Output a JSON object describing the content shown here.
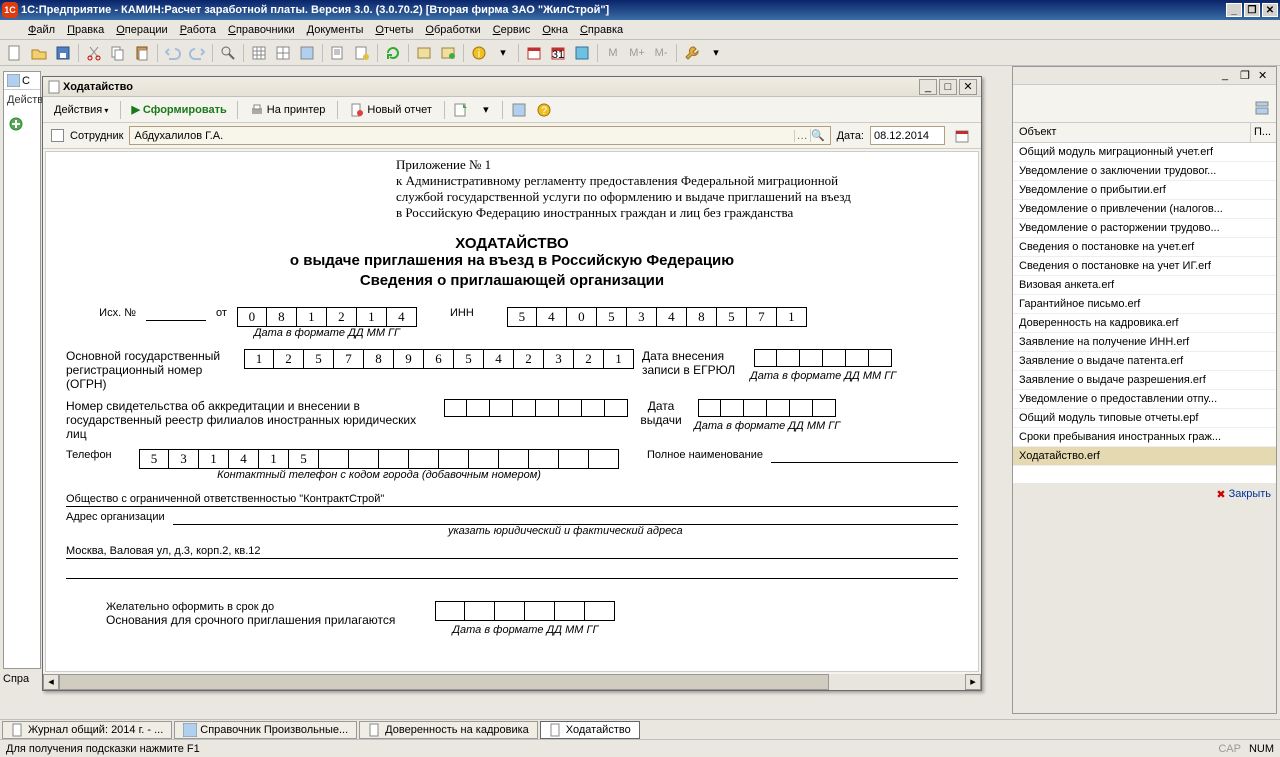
{
  "titlebar": "1С:Предприятие - КАМИН:Расчет заработной платы. Версия 3.0. (3.0.70.2) [Вторая фирма ЗАО \"ЖилСтрой\"]",
  "menu": [
    "Файл",
    "Правка",
    "Операции",
    "Работа",
    "Справочники",
    "Документы",
    "Отчеты",
    "Обработки",
    "Сервис",
    "Окна",
    "Справка"
  ],
  "leftbg": {
    "label1": "Действ",
    "label2": "Спра"
  },
  "modal": {
    "title": "Ходатайство",
    "actions": "Действия",
    "form": "Сформировать",
    "print": "На принтер",
    "newrep": "Новый отчет",
    "emp_label": "Сотрудник",
    "emp_value": "Абдухалилов Г.А.",
    "date_label": "Дата:",
    "date_value": "08.12.2014"
  },
  "doc": {
    "app_n": "Приложение № 1",
    "app_l1": "к Административному регламенту предоставления Федеральной миграционной",
    "app_l2": "службой государственной услуги по оформлению и выдаче приглашений на въезд",
    "app_l3": "в Российскую Федерацию иностранных граждан и лиц без гражданства",
    "h1": "ХОДАТАЙСТВО",
    "h2": "о выдаче приглашения на въезд в Российскую Федерацию",
    "h3": "Сведения о приглашающей организации",
    "ish": "Исх. №",
    "ot": "от",
    "date_cells": [
      "0",
      "8",
      "1",
      "2",
      "1",
      "4"
    ],
    "date_fmt": "Дата в формате ДД ММ ГГ",
    "inn_lbl": "ИНН",
    "inn": [
      "5",
      "4",
      "0",
      "5",
      "3",
      "4",
      "8",
      "5",
      "7",
      "1"
    ],
    "ogrn_lbl": "Основной государственный регистрационный номер (ОГРН)",
    "ogrn": [
      "1",
      "2",
      "5",
      "7",
      "8",
      "9",
      "6",
      "5",
      "4",
      "2",
      "3",
      "2",
      "1"
    ],
    "egrul": "Дата внесения записи в ЕГРЮЛ",
    "svid": "Номер свидетельства об аккредитации и внесении в государственный реестр филиалов иностранных юридических лиц",
    "dvyd": "Дата выдачи",
    "tel_lbl": "Телефон",
    "tel": [
      "5",
      "3",
      "1",
      "4",
      "1",
      "5"
    ],
    "tel_hint": "Контактный телефон с кодом города (добавочным номером)",
    "fullname": "Полное наименование",
    "org": "Общество с ограниченной ответственностью \"КонтрактСтрой\"",
    "addr_lbl": "Адрес организации",
    "addr_hint": "указать  юридический и фактический адреса",
    "addr": "Москва, Валовая ул, д.3, корп.2, кв.12",
    "wish": "Желательно оформить в срок до",
    "reason": "Основания для срочного приглашения прилагаются"
  },
  "right": {
    "col1": "Объект",
    "col2": "П...",
    "items": [
      "Общий модуль миграционный учет.erf",
      "Уведомление о заключении трудовог...",
      "Уведомление о прибытии.erf",
      "Уведомление о привлечении (налогов...",
      "Уведомление о расторжении трудово...",
      "Сведения о постановке на учет.erf",
      "Сведения о постановке на учет ИГ.erf",
      "Визовая анкета.erf",
      "Гарантийное письмо.erf",
      "Доверенность на кадровика.erf",
      "Заявление на получение ИНН.erf",
      "Заявление о выдаче патента.erf",
      "Заявление о выдаче разрешения.erf",
      "Уведомление о предоставлении отпу...",
      "Общий модуль типовые отчеты.epf",
      "Сроки пребывания иностранных граж...",
      "Ходатайство.erf"
    ],
    "close": "Закрыть"
  },
  "taskbar": [
    "Журнал общий: 2014 г. - ...",
    "Справочник Произвольные...",
    "Доверенность на кадровика",
    "Ходатайство"
  ],
  "status": {
    "hint": "Для получения подсказки нажмите F1",
    "cap": "CAP",
    "num": "NUM"
  }
}
